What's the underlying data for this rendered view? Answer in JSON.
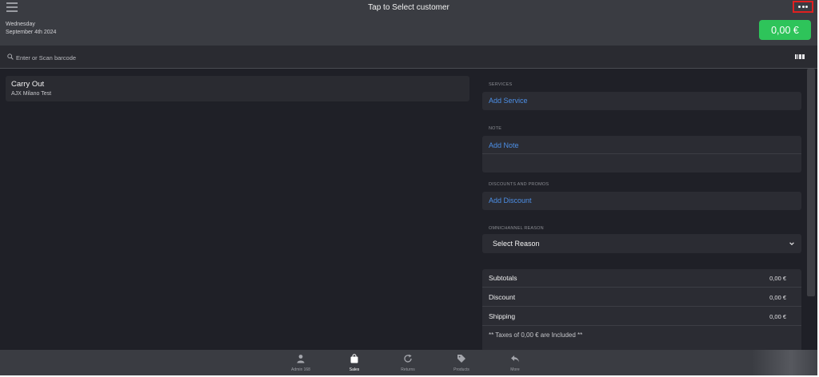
{
  "header": {
    "title": "Tap to Select customer",
    "day": "Wednesday",
    "date": "September 4th 2024",
    "total": "0,00 €",
    "more_icon": "more-dots-icon",
    "menu_icon": "hamburger-menu-icon"
  },
  "search": {
    "placeholder": "Enter or Scan barcode",
    "icon": "search-icon",
    "barcode_icon": "barcode-icon"
  },
  "order": {
    "title": "Carry Out",
    "subtitle": "AJX Milano Test"
  },
  "services": {
    "label": "SERVICES",
    "action": "Add Service"
  },
  "note": {
    "label": "NOTE",
    "action": "Add Note"
  },
  "discounts": {
    "label": "DISCOUNTS AND PROMOS",
    "action": "Add Discount"
  },
  "omnichannel": {
    "label": "OMNICHANNEL REASON",
    "selected": "Select Reason"
  },
  "totals": {
    "rows": [
      {
        "label": "Subtotals",
        "value": "0,00 €"
      },
      {
        "label": "Discount",
        "value": "0,00 €"
      },
      {
        "label": "Shipping",
        "value": "0,00 €"
      }
    ],
    "tax_note": "** Taxes of 0,00 € are Included **"
  },
  "nav": {
    "items": [
      {
        "label": "Admin 168",
        "icon": "person-icon",
        "active": false
      },
      {
        "label": "Sales",
        "icon": "shopping-bag-icon",
        "active": true
      },
      {
        "label": "Returns",
        "icon": "refresh-icon",
        "active": false
      },
      {
        "label": "Products",
        "icon": "tags-icon",
        "active": false
      },
      {
        "label": "More",
        "icon": "reply-arrow-icon",
        "active": false
      }
    ]
  },
  "colors": {
    "background": "#1f2027",
    "header": "#3a3c42",
    "panel": "#2b2c33",
    "accent_green": "#2ec45a",
    "link_blue": "#4d8fe6",
    "highlight_red": "#e02020"
  }
}
